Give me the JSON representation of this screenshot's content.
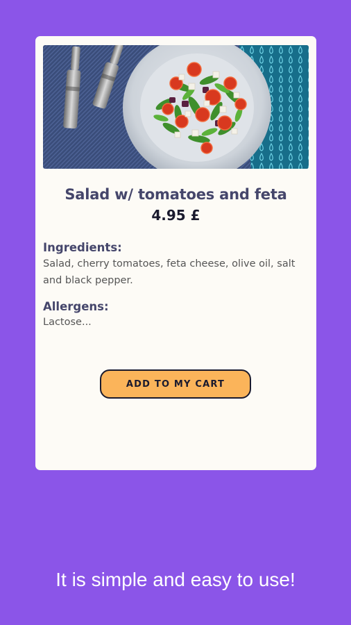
{
  "card": {
    "title": "Salad w/ tomatoes and feta",
    "price": "4.95 £",
    "ingredients_label": "Ingredients:",
    "ingredients_text": "Salad, cherry tomatoes, feta cheese, olive oil, salt and black pepper.",
    "allergens_label": "Allergens:",
    "allergens_text": "Lactose...",
    "button_label": "ADD TO MY CART"
  },
  "tagline": "It is simple and easy to use!",
  "colors": {
    "background": "#8b55e8",
    "card": "#fdfbf6",
    "button": "#fbb45a",
    "heading": "#45466b"
  }
}
